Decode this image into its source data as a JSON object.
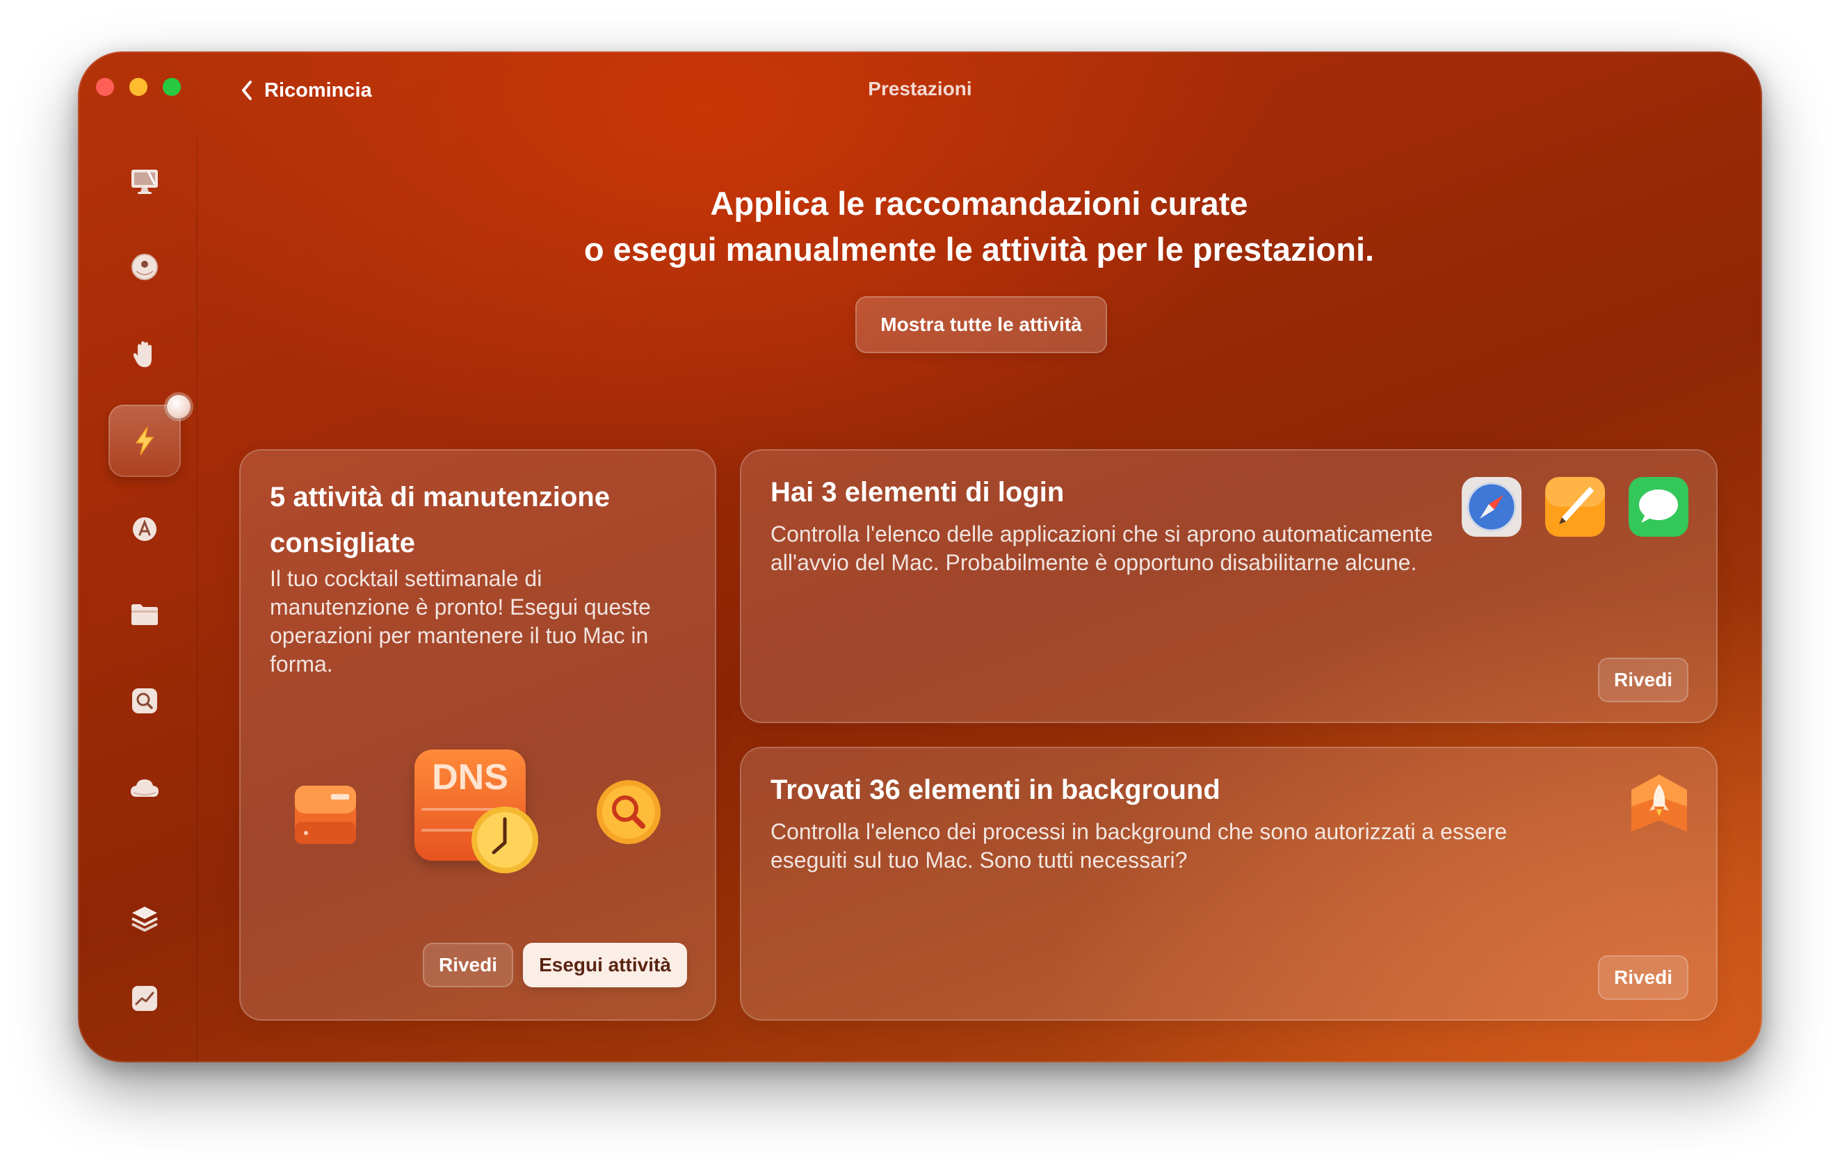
{
  "window": {
    "title": "Prestazioni",
    "back_label": "Ricomincia"
  },
  "sidebar": {
    "items": [
      {
        "icon": "monitor-broom-icon"
      },
      {
        "icon": "shield-ball-icon"
      },
      {
        "icon": "hand-icon"
      },
      {
        "icon": "bolt-icon",
        "active": true
      },
      {
        "icon": "apps-icon"
      },
      {
        "icon": "folder-icon"
      },
      {
        "icon": "space-lens-icon"
      },
      {
        "icon": "cloud-icon"
      },
      {
        "icon": "layers-icon"
      },
      {
        "icon": "chart-icon"
      }
    ]
  },
  "header": {
    "line1": "Applica le raccomandazioni curate",
    "line2": "o esegui manualmente le attività per le prestazioni.",
    "show_all_label": "Mostra tutte le attività"
  },
  "cards": {
    "maintenance": {
      "title": "5 attività di manutenzione consigliate",
      "description": "Il tuo cocktail settimanale di manutenzione è pronto! Esegui queste operazioni per mantenere il tuo Mac in forma.",
      "dns_label": "DNS",
      "review_label": "Rivedi",
      "run_label": "Esegui attività"
    },
    "login_items": {
      "title": "Hai 3 elementi di login",
      "description": "Controlla l'elenco delle applicazioni che si aprono automaticamente all'avvio del Mac. Probabilmente è opportuno disabilitarne alcune.",
      "review_label": "Rivedi",
      "apps": [
        "safari-icon",
        "pages-icon",
        "messages-icon"
      ]
    },
    "background_items": {
      "title": "Trovati 36 elementi in background",
      "description": "Controlla l'elenco dei processi in background che sono autorizzati a essere eseguiti sul tuo Mac. Sono tutti necessari?",
      "review_label": "Rivedi"
    }
  },
  "colors": {
    "accent": "#b53208",
    "close": "#ff5f57",
    "minimize": "#febc2e",
    "maximize": "#28c840"
  }
}
